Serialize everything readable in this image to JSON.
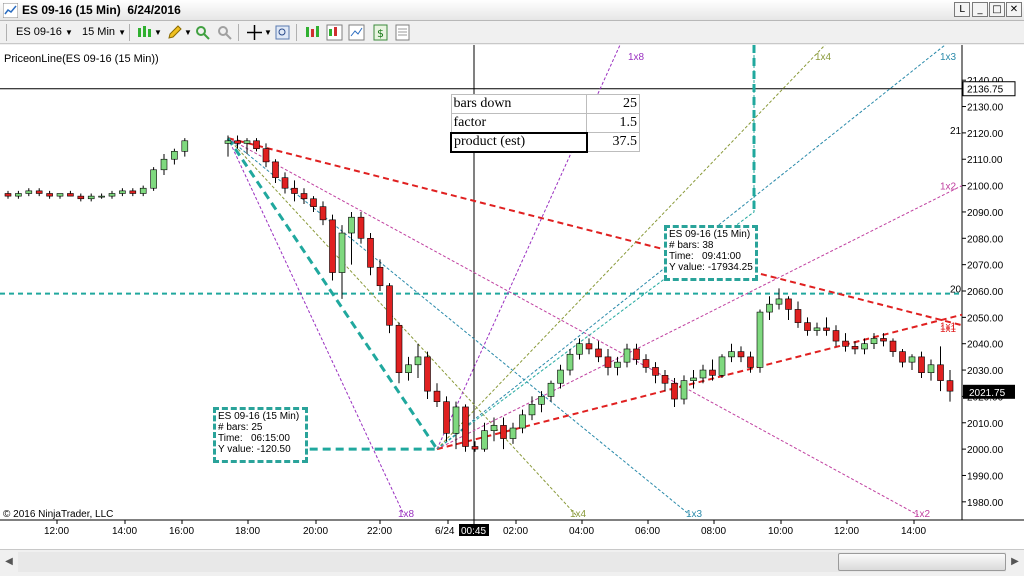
{
  "window": {
    "title": "ES 09-16 (15 Min)  6/24/2016",
    "buttons": {
      "restore": "L",
      "minimize": "_",
      "maximize": "□",
      "close": "✕"
    }
  },
  "toolbar": {
    "instrument": "ES 09-16",
    "interval": "15 Min"
  },
  "indicator_label": "PriceonLine(ES 09-16 (15 Min))",
  "copyright": "© 2016 NinjaTrader, LLC",
  "data_table": {
    "rows": [
      {
        "label": "bars down",
        "value": "25"
      },
      {
        "label": "factor",
        "value": "1.5"
      },
      {
        "label": "product (est)",
        "value": "37.5"
      }
    ]
  },
  "info_box_left": {
    "instrument": "ES 09-16 (15 Min)",
    "bars_label": "# bars:",
    "bars": "25",
    "time_label": "Time:",
    "time": "06:15:00",
    "y_label": "Y value:",
    "y": "-120.50"
  },
  "info_box_right": {
    "instrument": "ES 09-16 (15 Min)",
    "bars_label": "# bars:",
    "bars": "38",
    "time_label": "Time:",
    "time": "09:41:00",
    "y_label": "Y value:",
    "y": "-17934.25"
  },
  "colors": {
    "up_candle": "#7fd97f",
    "down_candle": "#e02020",
    "teal": "#20a89e",
    "red_dashed": "#e02020",
    "purple": "#9a30c0",
    "olive": "#8a9a3a",
    "blue": "#2a8aaa",
    "magenta": "#c040a0"
  },
  "chart_data": {
    "type": "candlestick",
    "y_axis": {
      "min": 1975,
      "max": 2145,
      "ticks": [
        "2140.00",
        "2130.00",
        "2120.00",
        "2110.00",
        "2100.00",
        "2090.00",
        "2080.00",
        "2070.00",
        "2060.00",
        "2050.00",
        "2040.00",
        "2030.00",
        "2020.00",
        "2010.00",
        "2000.00",
        "1990.00",
        "1980.00"
      ],
      "last_price": "2021.75",
      "crosshair_price": "2136.75"
    },
    "x_axis": {
      "ticks": [
        "12:00",
        "14:00",
        "16:00",
        "18:00",
        "20:00",
        "22:00",
        "6/24",
        "00:45",
        "02:00",
        "04:00",
        "06:00",
        "08:00",
        "10:00",
        "12:00",
        "14:00"
      ]
    },
    "gann_labels": [
      "1x8",
      "1x4",
      "1x3",
      "1x2",
      "1x1",
      "21",
      "20",
      "1x8",
      "1x4",
      "1x3",
      "1x2",
      "1x1"
    ],
    "candles": [
      [
        2097,
        2098,
        2095,
        2096
      ],
      [
        2096,
        2098,
        2095,
        2097
      ],
      [
        2097,
        2099,
        2096,
        2098
      ],
      [
        2098,
        2099,
        2096,
        2097
      ],
      [
        2097,
        2098,
        2095,
        2096
      ],
      [
        2096,
        2097,
        2095,
        2097
      ],
      [
        2097,
        2098,
        2096,
        2096
      ],
      [
        2096,
        2097,
        2094,
        2095
      ],
      [
        2095,
        2097,
        2094,
        2096
      ],
      [
        2096,
        2097,
        2095,
        2096
      ],
      [
        2096,
        2098,
        2095,
        2097
      ],
      [
        2097,
        2099,
        2096,
        2098
      ],
      [
        2098,
        2099,
        2096,
        2097
      ],
      [
        2097,
        2100,
        2096,
        2099
      ],
      [
        2099,
        2107,
        2098,
        2106
      ],
      [
        2106,
        2112,
        2104,
        2110
      ],
      [
        2110,
        2114,
        2108,
        2113
      ],
      [
        2113,
        2118,
        2111,
        2117
      ],
      [
        2116,
        2119,
        2111,
        2117
      ],
      [
        2117,
        2119,
        2114,
        2116
      ],
      [
        2116,
        2118,
        2112,
        2117
      ],
      [
        2117,
        2118,
        2113,
        2114
      ],
      [
        2114,
        2116,
        2107,
        2109
      ],
      [
        2109,
        2110,
        2101,
        2103
      ],
      [
        2103,
        2105,
        2097,
        2099
      ],
      [
        2099,
        2102,
        2094,
        2097
      ],
      [
        2097,
        2099,
        2093,
        2095
      ],
      [
        2095,
        2096,
        2090,
        2092
      ],
      [
        2092,
        2094,
        2085,
        2087
      ],
      [
        2087,
        2089,
        2064,
        2067
      ],
      [
        2067,
        2085,
        2057,
        2082
      ],
      [
        2082,
        2090,
        2070,
        2088
      ],
      [
        2088,
        2090,
        2078,
        2080
      ],
      [
        2080,
        2082,
        2066,
        2069
      ],
      [
        2069,
        2072,
        2060,
        2062
      ],
      [
        2062,
        2063,
        2044,
        2047
      ],
      [
        2047,
        2048,
        2025,
        2029
      ],
      [
        2029,
        2035,
        2026,
        2032
      ],
      [
        2032,
        2040,
        2027,
        2035
      ],
      [
        2035,
        2037,
        2019,
        2022
      ],
      [
        2022,
        2025,
        2016,
        2018
      ],
      [
        2018,
        2020,
        2003,
        2006
      ],
      [
        2006,
        2018,
        2000,
        2016
      ],
      [
        2016,
        2017,
        1999,
        2001
      ],
      [
        2001,
        2003,
        1999,
        2000
      ],
      [
        2000,
        2010,
        1999,
        2007
      ],
      [
        2007,
        2012,
        2003,
        2009
      ],
      [
        2009,
        2012,
        2000,
        2004
      ],
      [
        2004,
        2010,
        2002,
        2008
      ],
      [
        2008,
        2015,
        2006,
        2013
      ],
      [
        2013,
        2020,
        2011,
        2017
      ],
      [
        2017,
        2022,
        2014,
        2020
      ],
      [
        2020,
        2026,
        2018,
        2025
      ],
      [
        2025,
        2032,
        2023,
        2030
      ],
      [
        2030,
        2038,
        2028,
        2036
      ],
      [
        2036,
        2042,
        2034,
        2040
      ],
      [
        2040,
        2042,
        2036,
        2038
      ],
      [
        2038,
        2041,
        2033,
        2035
      ],
      [
        2035,
        2038,
        2028,
        2031
      ],
      [
        2031,
        2035,
        2028,
        2033
      ],
      [
        2033,
        2040,
        2031,
        2038
      ],
      [
        2038,
        2040,
        2032,
        2034
      ],
      [
        2034,
        2036,
        2029,
        2031
      ],
      [
        2031,
        2033,
        2025,
        2028
      ],
      [
        2028,
        2030,
        2022,
        2025
      ],
      [
        2025,
        2027,
        2016,
        2019
      ],
      [
        2019,
        2028,
        2017,
        2026
      ],
      [
        2026,
        2030,
        2023,
        2027
      ],
      [
        2027,
        2032,
        2025,
        2030
      ],
      [
        2030,
        2034,
        2026,
        2028
      ],
      [
        2028,
        2036,
        2027,
        2035
      ],
      [
        2035,
        2040,
        2033,
        2037
      ],
      [
        2037,
        2039,
        2033,
        2035
      ],
      [
        2035,
        2037,
        2029,
        2031
      ],
      [
        2031,
        2053,
        2029,
        2052
      ],
      [
        2052,
        2058,
        2049,
        2055
      ],
      [
        2055,
        2061,
        2053,
        2057
      ],
      [
        2057,
        2058,
        2049,
        2053
      ],
      [
        2053,
        2056,
        2046,
        2048
      ],
      [
        2048,
        2050,
        2043,
        2045
      ],
      [
        2045,
        2048,
        2043,
        2046
      ],
      [
        2046,
        2050,
        2043,
        2045
      ],
      [
        2045,
        2047,
        2039,
        2041
      ],
      [
        2041,
        2044,
        2037,
        2039
      ],
      [
        2039,
        2041,
        2036,
        2038
      ],
      [
        2038,
        2042,
        2036,
        2040
      ],
      [
        2040,
        2044,
        2038,
        2042
      ],
      [
        2042,
        2044,
        2039,
        2041
      ],
      [
        2041,
        2042,
        2035,
        2037
      ],
      [
        2037,
        2038,
        2031,
        2033
      ],
      [
        2033,
        2036,
        2030,
        2035
      ],
      [
        2035,
        2037,
        2027,
        2029
      ],
      [
        2029,
        2034,
        2026,
        2032
      ],
      [
        2032,
        2039,
        2022,
        2026
      ],
      [
        2026,
        2030,
        2018,
        2022
      ]
    ]
  }
}
